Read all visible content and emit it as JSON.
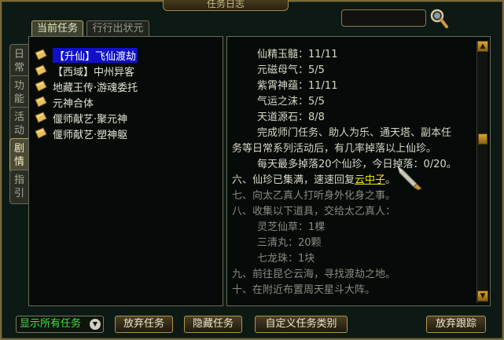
{
  "window": {
    "title": "任务日志"
  },
  "tabs": [
    {
      "label": "当前任务",
      "active": true
    },
    {
      "label": "行行出状元",
      "active": false
    }
  ],
  "side_tabs": [
    {
      "label": "日常",
      "active": false
    },
    {
      "label": "功能",
      "active": false
    },
    {
      "label": "活动",
      "active": false
    },
    {
      "label": "剧情",
      "active": true
    },
    {
      "label": "指引",
      "active": false
    }
  ],
  "quests": [
    {
      "label": "【升仙】飞仙渡劫",
      "selected": true
    },
    {
      "label": "【西域】中州异客",
      "selected": false
    },
    {
      "label": "地藏王传·游魂委托",
      "selected": false
    },
    {
      "label": "元神合体",
      "selected": false
    },
    {
      "label": "偃师献艺·聚元神",
      "selected": false
    },
    {
      "label": "偃师献艺·塑神躯",
      "selected": false
    }
  ],
  "details": {
    "items": [
      "仙精玉髓：11/11",
      "元磁母气：5/5",
      "紫霄神蕴：11/11",
      "气运之沫：5/5",
      "天道源石：8/8"
    ],
    "desc_1": "完成师门任务、助人为乐、通天塔、副本任",
    "desc_2": "务等日常系列活动后，有几率掉落以上仙珍。",
    "desc_3": "每天最多掉落20个仙珍，今日掉落：0/20。",
    "step6_prefix": "六、仙珍已集满，速速回复",
    "step6_link": "云中子",
    "step6_suffix": "。",
    "step7": "七、向太乙真人打听身外化身之事。",
    "step8": "八、收集以下道具，交给太乙真人：",
    "step8_items": [
      "灵芝仙草：1棵",
      "三清丸：20颗",
      "七龙珠：1块"
    ],
    "step9": "九、前往昆仑云海，寻找渡劫之地。",
    "step10": "十、在附近布置周天星斗大阵。"
  },
  "footer": {
    "filter_label": "显示所有任务",
    "abandon_label": "放弃任务",
    "hide_label": "隐藏任务",
    "custom_label": "自定义任务类别",
    "stop_track_label": "放弃跟踪"
  },
  "colors": {
    "selected_bg": "#1010c8",
    "link": "#f0e020",
    "filter_text": "#40e040",
    "gold_border": "#b0944a"
  }
}
